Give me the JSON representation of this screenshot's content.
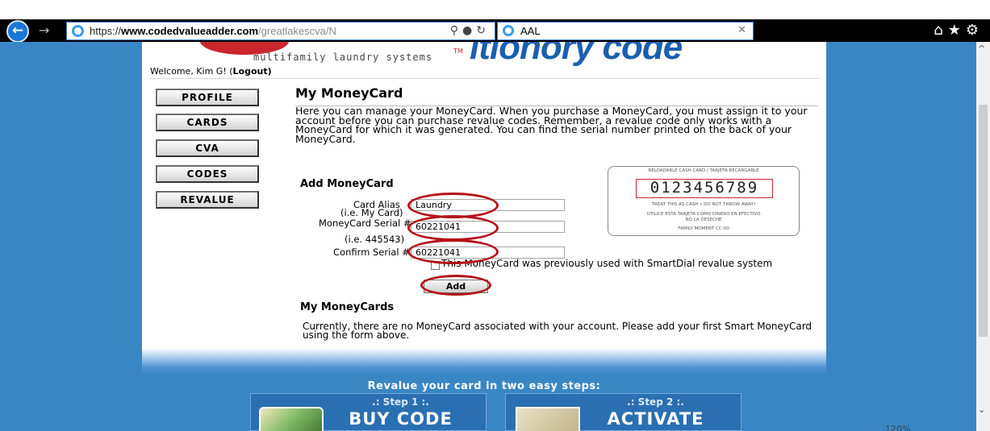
{
  "browser": {
    "url_protocol": "https://",
    "url_host": "www.codedvalueadder.com",
    "url_path": "/greatlakescva/N",
    "tab_title": "AAL",
    "zoom": "120%"
  },
  "header": {
    "logo_subtitle": "multifamily laundry systems",
    "logo_big": "itionory code",
    "logo_tm": "TM",
    "welcome_prefix": "Welcome, Kim G! (",
    "logout_label": "Logout",
    "welcome_suffix": ")"
  },
  "menu": {
    "items": [
      {
        "label": "PROFILE"
      },
      {
        "label": "CARDS"
      },
      {
        "label": "CVA"
      },
      {
        "label": "CODES"
      },
      {
        "label": "REVALUE"
      }
    ]
  },
  "main": {
    "title": "My MoneyCard",
    "intro": "Here you can manage your MoneyCard. When you purchase a MoneyCard, you must assign it to your account before you can purchase revalue codes. Remember, a revalue code only works with a MoneyCard for which it was generated. You can find the serial number printed on the back of your MoneyCard."
  },
  "add_form": {
    "title": "Add MoneyCard",
    "alias_label": "Card Alias",
    "alias_hint": "(i.e. My Card)",
    "alias_value": "Laundry",
    "serial_label": "MoneyCard Serial #",
    "serial_hint": "(i.e. 445543)",
    "serial_value": "60221041",
    "confirm_label": "Confirm Serial #",
    "confirm_value": "60221041",
    "smartdial_label": "This MoneyCard was previously used with SmartDial revalue system",
    "add_button": "Add"
  },
  "sample_card": {
    "top_text": "RELOADABLE CASH CARD / TARJETA RECARGABLE",
    "serial": "0123456789",
    "line1": "TREAT THIS AS CASH • DO NOT THROW AWAY!",
    "line2": "UTILICE ESTA TARJETA COMO DINERO EN EFECTIVO",
    "line3": "NO LA DESECHE",
    "line4": "FAMILY MOMENT          CC-00"
  },
  "my_cards": {
    "title": "My MoneyCards",
    "message": "Currently, there are no MoneyCard associated with your account. Please add your first Smart MoneyCard using the form above."
  },
  "footer": {
    "revalue_title": "Revalue your card in two easy steps:",
    "step1_label": ".: Step 1 :.",
    "step1_action": "BUY CODE",
    "step2_label": ".: Step 2 :.",
    "step2_action": "ACTIVATE"
  },
  "colors": {
    "highlight_oval": "#b5121b",
    "page_blue": "#3a86c4",
    "logo_blue": "#1b5fb0"
  }
}
